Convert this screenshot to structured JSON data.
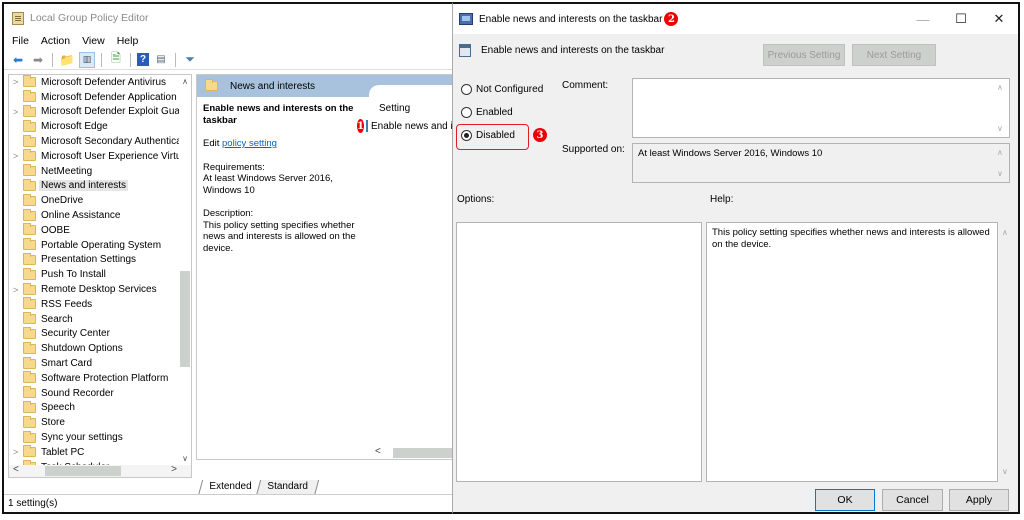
{
  "gpedit": {
    "title": "Local Group Policy Editor",
    "menu": [
      "File",
      "Action",
      "View",
      "Help"
    ],
    "toolbar_icons": [
      "back-arrow-icon",
      "forward-arrow-icon",
      "up-folder-icon",
      "show-hide-tree-icon",
      "export-list-icon",
      "help-icon",
      "properties-icon",
      "filter-icon"
    ],
    "tree": [
      {
        "label": "Microsoft Defender Antivirus",
        "expandable": true
      },
      {
        "label": "Microsoft Defender Application Guard",
        "expandable": false
      },
      {
        "label": "Microsoft Defender Exploit Guard",
        "expandable": true
      },
      {
        "label": "Microsoft Edge",
        "expandable": false
      },
      {
        "label": "Microsoft Secondary Authentication Factor",
        "expandable": false
      },
      {
        "label": "Microsoft User Experience Virtualization",
        "expandable": true
      },
      {
        "label": "NetMeeting",
        "expandable": false
      },
      {
        "label": "News and interests",
        "expandable": false,
        "selected": true
      },
      {
        "label": "OneDrive",
        "expandable": false
      },
      {
        "label": "Online Assistance",
        "expandable": false
      },
      {
        "label": "OOBE",
        "expandable": false
      },
      {
        "label": "Portable Operating System",
        "expandable": false
      },
      {
        "label": "Presentation Settings",
        "expandable": false
      },
      {
        "label": "Push To Install",
        "expandable": false
      },
      {
        "label": "Remote Desktop Services",
        "expandable": true
      },
      {
        "label": "RSS Feeds",
        "expandable": false
      },
      {
        "label": "Search",
        "expandable": false
      },
      {
        "label": "Security Center",
        "expandable": false
      },
      {
        "label": "Shutdown Options",
        "expandable": false
      },
      {
        "label": "Smart Card",
        "expandable": false
      },
      {
        "label": "Software Protection Platform",
        "expandable": false
      },
      {
        "label": "Sound Recorder",
        "expandable": false
      },
      {
        "label": "Speech",
        "expandable": false
      },
      {
        "label": "Store",
        "expandable": false
      },
      {
        "label": "Sync your settings",
        "expandable": false
      },
      {
        "label": "Tablet PC",
        "expandable": true
      },
      {
        "label": "Task Scheduler",
        "expandable": false
      }
    ],
    "detail": {
      "header": "News and interests",
      "policy_title": "Enable news and interests on the taskbar",
      "edit_prefix": "Edit ",
      "edit_link": "policy setting",
      "requirements_label": "Requirements:",
      "requirements_text": "At least Windows Server 2016, Windows 10",
      "description_label": "Description:",
      "description_text": "This policy setting specifies whether news and interests is allowed on the device.",
      "setting_header": "Setting",
      "setting_row": "Enable news and interests on the taskbar",
      "badge": "1"
    },
    "tabs": [
      "Extended",
      "Standard"
    ],
    "status": "1 setting(s)"
  },
  "dialog": {
    "title": "Enable news and interests on the taskbar",
    "title_badge": "2",
    "subheading": "Enable news and interests on the taskbar",
    "prev_label": "Previous Setting",
    "next_label": "Next Setting",
    "radios": [
      {
        "label": "Not Configured",
        "checked": false
      },
      {
        "label": "Enabled",
        "checked": false
      },
      {
        "label": "Disabled",
        "checked": true
      }
    ],
    "disabled_badge": "3",
    "comment_label": "Comment:",
    "comment_value": "",
    "supported_label": "Supported on:",
    "supported_value": "At least Windows Server 2016, Windows 10",
    "options_label": "Options:",
    "help_label": "Help:",
    "help_text": "This policy setting specifies whether news and interests is allowed on the device.",
    "ok_label": "OK",
    "cancel_label": "Cancel",
    "apply_label": "Apply",
    "controls": {
      "minimize": "—",
      "maximize": "☐",
      "close": "✕"
    }
  }
}
